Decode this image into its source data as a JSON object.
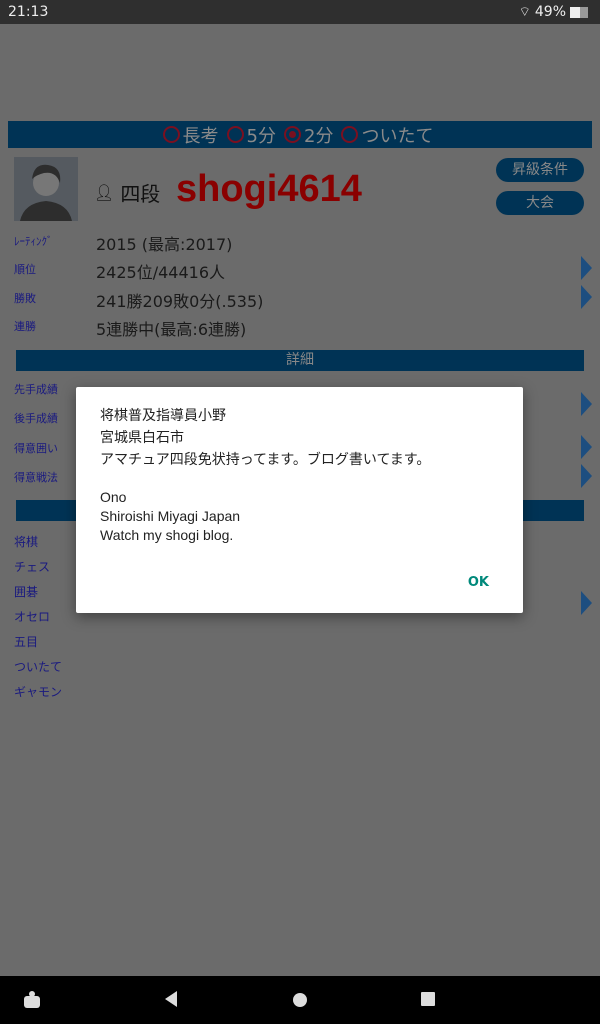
{
  "status": {
    "time": "21:13",
    "battery": "49%",
    "battery_level": 0.49
  },
  "modes": [
    {
      "label": "長考",
      "selected": false
    },
    {
      "label": "5分",
      "selected": false
    },
    {
      "label": "2分",
      "selected": true
    },
    {
      "label": "ついたて",
      "selected": false
    }
  ],
  "profile": {
    "rank": "四段",
    "username": "shogi4614",
    "promotion_button": "昇級条件",
    "tournament_button": "大会"
  },
  "stats": [
    {
      "label": "ﾚｰﾃｨﾝｸﾞ",
      "value": "2015 (最高:2017)"
    },
    {
      "label": "順位",
      "value": "2425位/44416人"
    },
    {
      "label": "勝敗",
      "value": "241勝209敗0分(.535)"
    },
    {
      "label": "連勝",
      "value": "5連勝中(最高:6連勝)"
    }
  ],
  "details_header": "詳細",
  "details": [
    {
      "label": "先手成績"
    },
    {
      "label": "後手成績"
    },
    {
      "label": "得意囲い"
    },
    {
      "label": "得意戦法"
    }
  ],
  "games": [
    "将棋",
    "チェス",
    "囲碁",
    "オセロ",
    "五目",
    "ついたて",
    "ギャモン"
  ],
  "dialog": {
    "lines": [
      "将棋普及指導員小野",
      "宮城県白石市",
      "アマチュア四段免状持ってます。ブログ書いてます。"
    ],
    "lines_en": [
      "Ono",
      "Shiroishi Miyagi Japan",
      "Watch my shogi blog."
    ],
    "ok": "OK"
  },
  "colors": {
    "header": "#003355",
    "username": "#8a0000",
    "ok": "#00897b"
  }
}
